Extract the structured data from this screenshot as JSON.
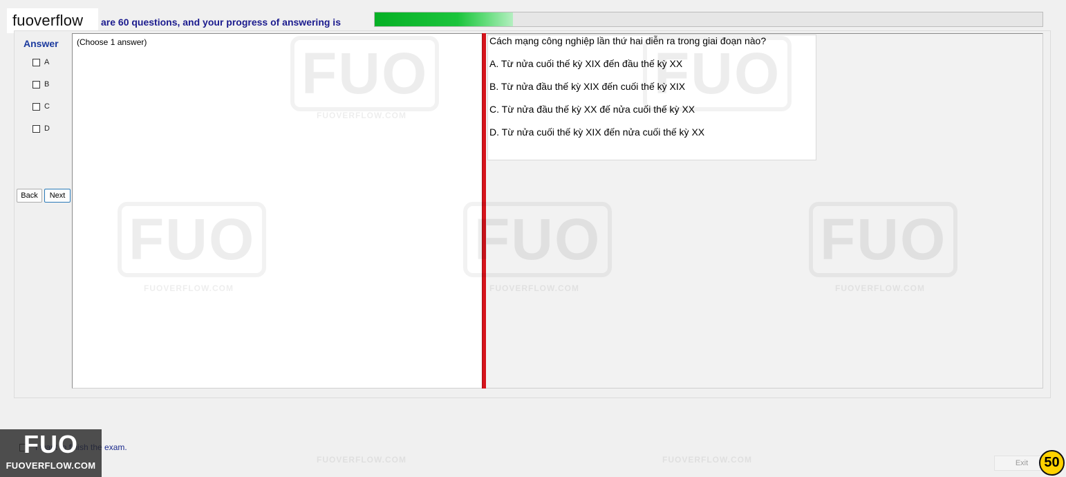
{
  "header": {
    "brand": "fuoverflow",
    "progress_text": "are 60 questions, and your progress of answering is",
    "progress_fraction": 0.207
  },
  "sidebar": {
    "answer_label": "Answer",
    "options": [
      {
        "label": "A",
        "checked": false
      },
      {
        "label": "B",
        "checked": false
      },
      {
        "label": "C",
        "checked": false
      },
      {
        "label": "D",
        "checked": false
      }
    ],
    "back_label": "Back",
    "next_label": "Next"
  },
  "left_pane": {
    "instruction": "(Choose 1 answer)"
  },
  "question": {
    "text": "Cách mạng công nghiệp lần thứ hai diễn ra trong giai đoạn nào?",
    "choices": [
      "A.  Từ nửa cuối thế kỳ XIX đến đầu thế kỳ XX",
      "B.  Từ nửa đầu thế kỳ XIX đến cuối thế kỳ XIX",
      "C.  Từ nửa đầu thế kỳ XX đế nửa cuối thế kỳ XX",
      "D.  Từ nửa cuối thế kỳ XIX đến nửa cuối thế kỳ XX"
    ]
  },
  "footer": {
    "finish_text": "I want to finish the exam.",
    "badge_big": "FUO",
    "badge_small": "FUOVERFLOW.COM",
    "exit_label": "Exit",
    "count": "50"
  },
  "colors": {
    "progress": "#06b025",
    "splitter": "#d6141c",
    "label_blue": "#1b1b8e",
    "badge": "#ffd200"
  }
}
